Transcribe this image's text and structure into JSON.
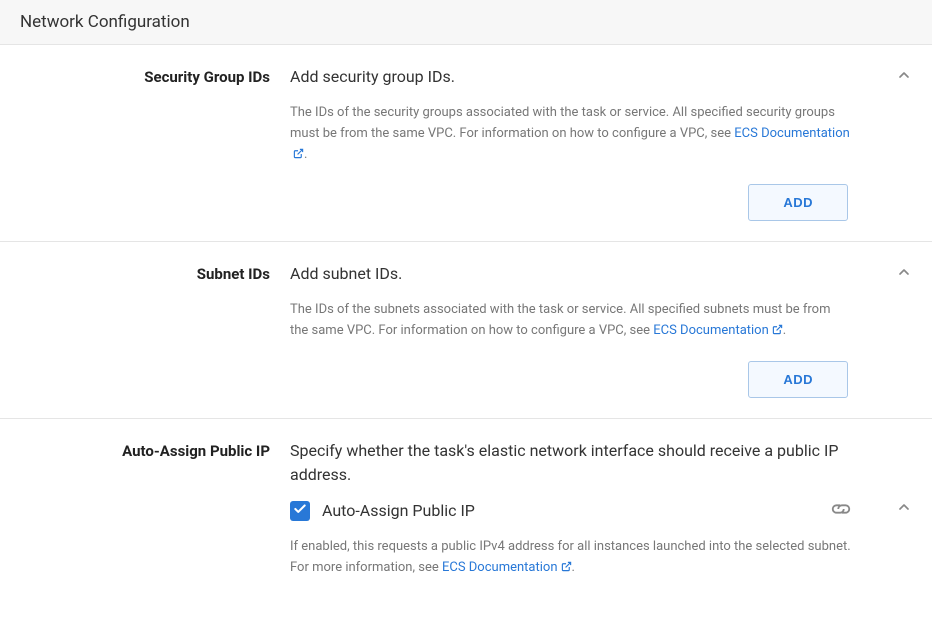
{
  "section": {
    "title": "Network Configuration"
  },
  "securityGroup": {
    "label": "Security Group IDs",
    "title": "Add security group IDs.",
    "descPrefix": "The IDs of the security groups associated with the task or service. All specified security groups must be from the same VPC. For information on how to configure a VPC, see ",
    "linkText": "ECS Documentation",
    "descSuffix": ".",
    "addButton": "ADD"
  },
  "subnet": {
    "label": "Subnet IDs",
    "title": "Add subnet IDs.",
    "descPrefix": "The IDs of the subnets associated with the task or service. All specified subnets must be from the same VPC. For information on how to configure a VPC, see ",
    "linkText": "ECS Documentation",
    "descSuffix": ".",
    "addButton": "ADD"
  },
  "publicIp": {
    "label": "Auto-Assign Public IP",
    "title": "Specify whether the task's elastic network interface should receive a public IP address.",
    "checkboxLabel": "Auto-Assign Public IP",
    "descPrefix": "If enabled, this requests a public IPv4 address for all instances launched into the selected subnet. For more information, see ",
    "linkText": "ECS Documentation",
    "descSuffix": "."
  }
}
